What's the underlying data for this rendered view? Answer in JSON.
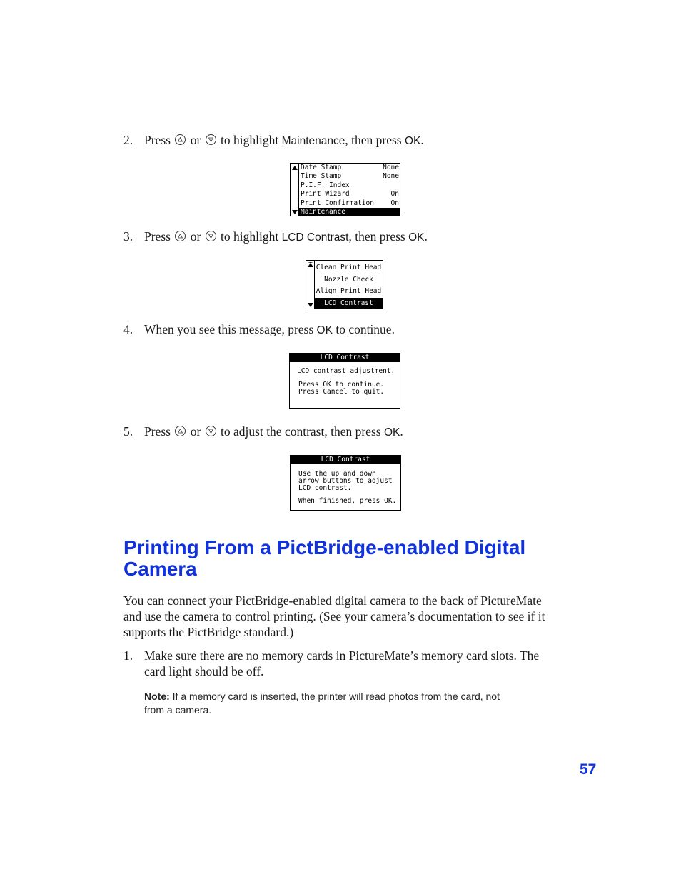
{
  "steps": [
    {
      "num": "2.",
      "press": "Press",
      "or": "or",
      "text_before": "to highlight",
      "keyword": "Maintenance",
      "text_after": ", then press",
      "ok": "OK",
      "end": "."
    },
    {
      "num": "3.",
      "press": "Press",
      "or": "or",
      "text_before": "to highlight",
      "keyword": "LCD Contrast",
      "text_after": ", then press",
      "ok": "OK",
      "end": "."
    },
    {
      "num": "4.",
      "text_before": "When you see this message, press",
      "ok": "OK",
      "text_after": "to continue."
    },
    {
      "num": "5.",
      "press": "Press",
      "or": "or",
      "text_before": "to adjust the contrast, then press",
      "ok": "OK",
      "end": "."
    }
  ],
  "icons": {
    "up": "up-button-icon",
    "down": "down-button-icon"
  },
  "lcd1": {
    "rows": [
      {
        "label": "Date Stamp",
        "value": "None"
      },
      {
        "label": "Time Stamp",
        "value": "None"
      },
      {
        "label": "P.I.F. Index",
        "value": ""
      },
      {
        "label": "Print Wizard",
        "value": "On"
      },
      {
        "label": "Print Confirmation",
        "value": "On"
      },
      {
        "label": "Maintenance",
        "value": ""
      }
    ],
    "selected": "Maintenance"
  },
  "lcd2": {
    "rows": [
      "Clean Print Head",
      "Nozzle Check",
      "Align Print Head",
      "LCD Contrast"
    ],
    "selected": "LCD Contrast"
  },
  "lcd3": {
    "title": "LCD Contrast",
    "line1": "LCD contrast adjustment.",
    "line2": "Press OK to continue.",
    "line3": "Press Cancel to quit."
  },
  "lcd4": {
    "title": "LCD Contrast",
    "line1": "Use the up and down",
    "line2": "arrow buttons to adjust",
    "line3": "LCD contrast.",
    "line4": "When finished, press OK."
  },
  "section": {
    "heading_line1": "Printing From a PictBridge-enabled Digital",
    "heading_line2": "Camera",
    "intro_line1": "You can connect your PictBridge-enabled digital camera to the back of PictureMate",
    "intro_line2": "and use the camera to control printing. (See your camera’s documentation to see if it",
    "intro_line3": "supports the PictBridge standard.)",
    "step1_num": "1.",
    "step1_line1": "Make sure there are no memory cards in PictureMate’s memory card slots. The",
    "step1_line2": "card light should be off.",
    "note_label": "Note:",
    "note_line1": "If a memory card is inserted, the printer will read photos from the card, not",
    "note_line2": "from a camera."
  },
  "page_number": "57",
  "colors": {
    "accent": "#1133dd"
  }
}
